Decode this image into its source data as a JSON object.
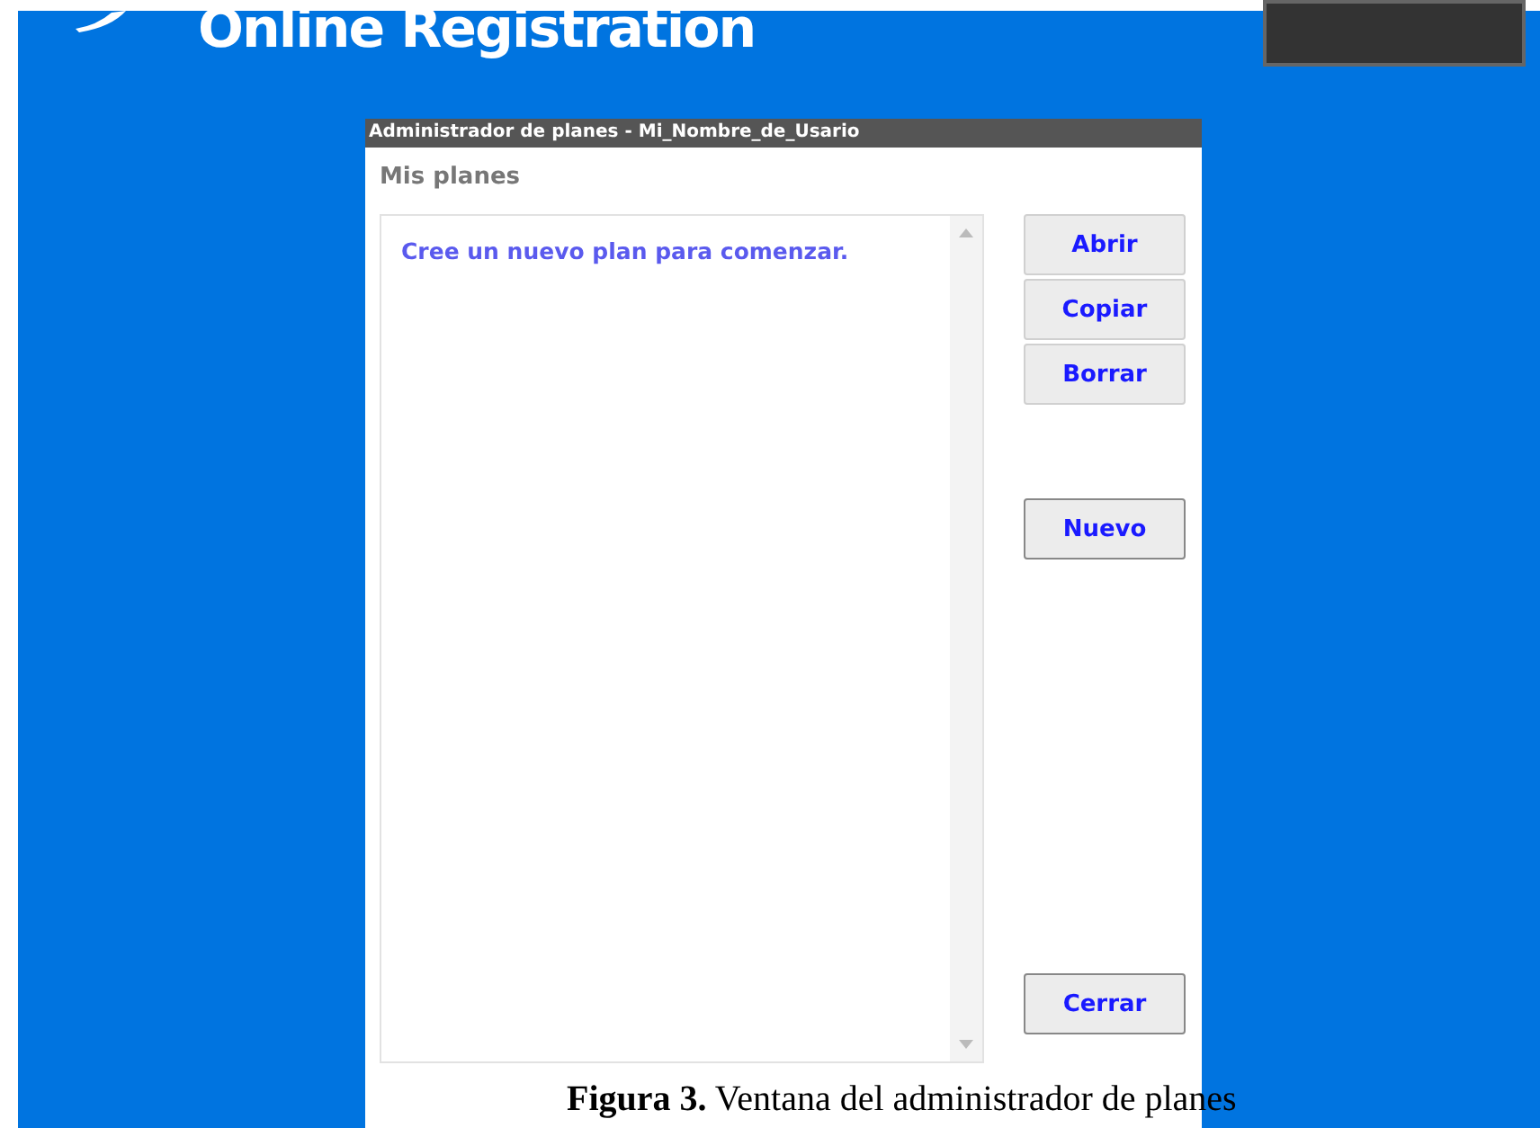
{
  "header": {
    "title": "Online Registration"
  },
  "dialog": {
    "title": "Administrador de planes - Mi_Nombre_de_Usario",
    "section": "Mis planes",
    "list": {
      "empty_message": "Cree un nuevo plan para comenzar."
    },
    "buttons": [
      {
        "label": "Abrir",
        "kind": "action"
      },
      {
        "label": "Copiar",
        "kind": "action"
      },
      {
        "label": "Borrar",
        "kind": "action"
      },
      {
        "label": "Nuevo",
        "kind": "primary"
      },
      {
        "label": "Cerrar",
        "kind": "close"
      }
    ]
  },
  "caption": {
    "text": "**Figura 3.** Ventana del administrador de planes"
  }
}
